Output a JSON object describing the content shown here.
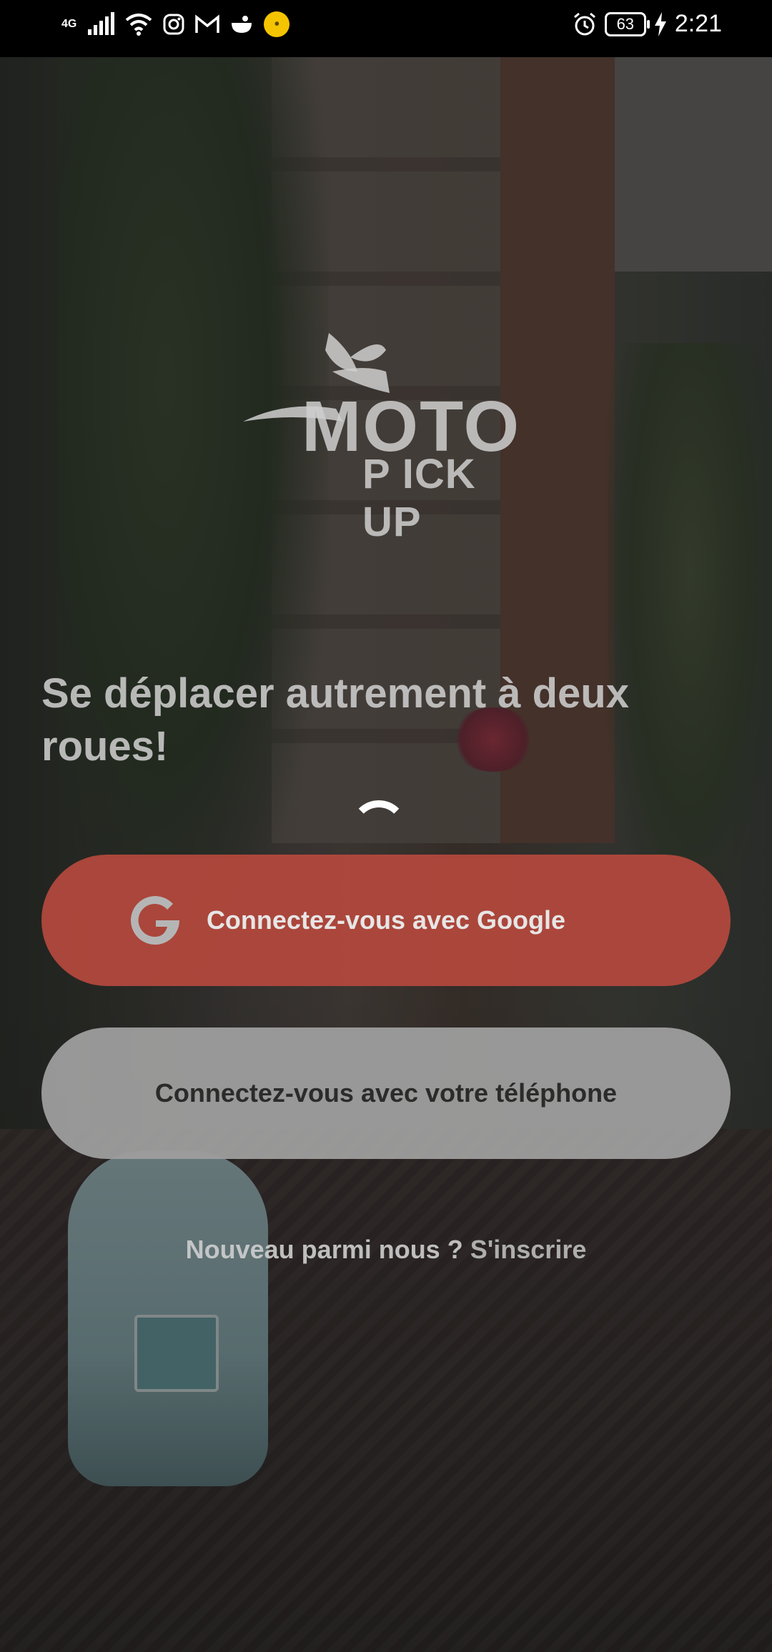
{
  "status_bar": {
    "network": "4G",
    "battery_level": "63",
    "time": "2:21",
    "icons": [
      "signal-icon",
      "wifi-icon",
      "instagram-icon",
      "gmail-icon",
      "app-icon",
      "notification-dot-icon",
      "alarm-icon",
      "battery-icon",
      "charging-icon"
    ]
  },
  "logo": {
    "line1": "MOTO",
    "line2": "P ICK UP"
  },
  "headline": "Se déplacer autrement à deux roues!",
  "buttons": {
    "google_label": "Connectez-vous avec Google",
    "phone_label": "Connectez-vous avec votre téléphone"
  },
  "signup": {
    "prompt": "Nouveau parmi nous ? ",
    "link": "S'inscrire"
  },
  "colors": {
    "google_button": "#b2483d",
    "phone_button": "#9e9e9e",
    "overlay": "#141414"
  }
}
